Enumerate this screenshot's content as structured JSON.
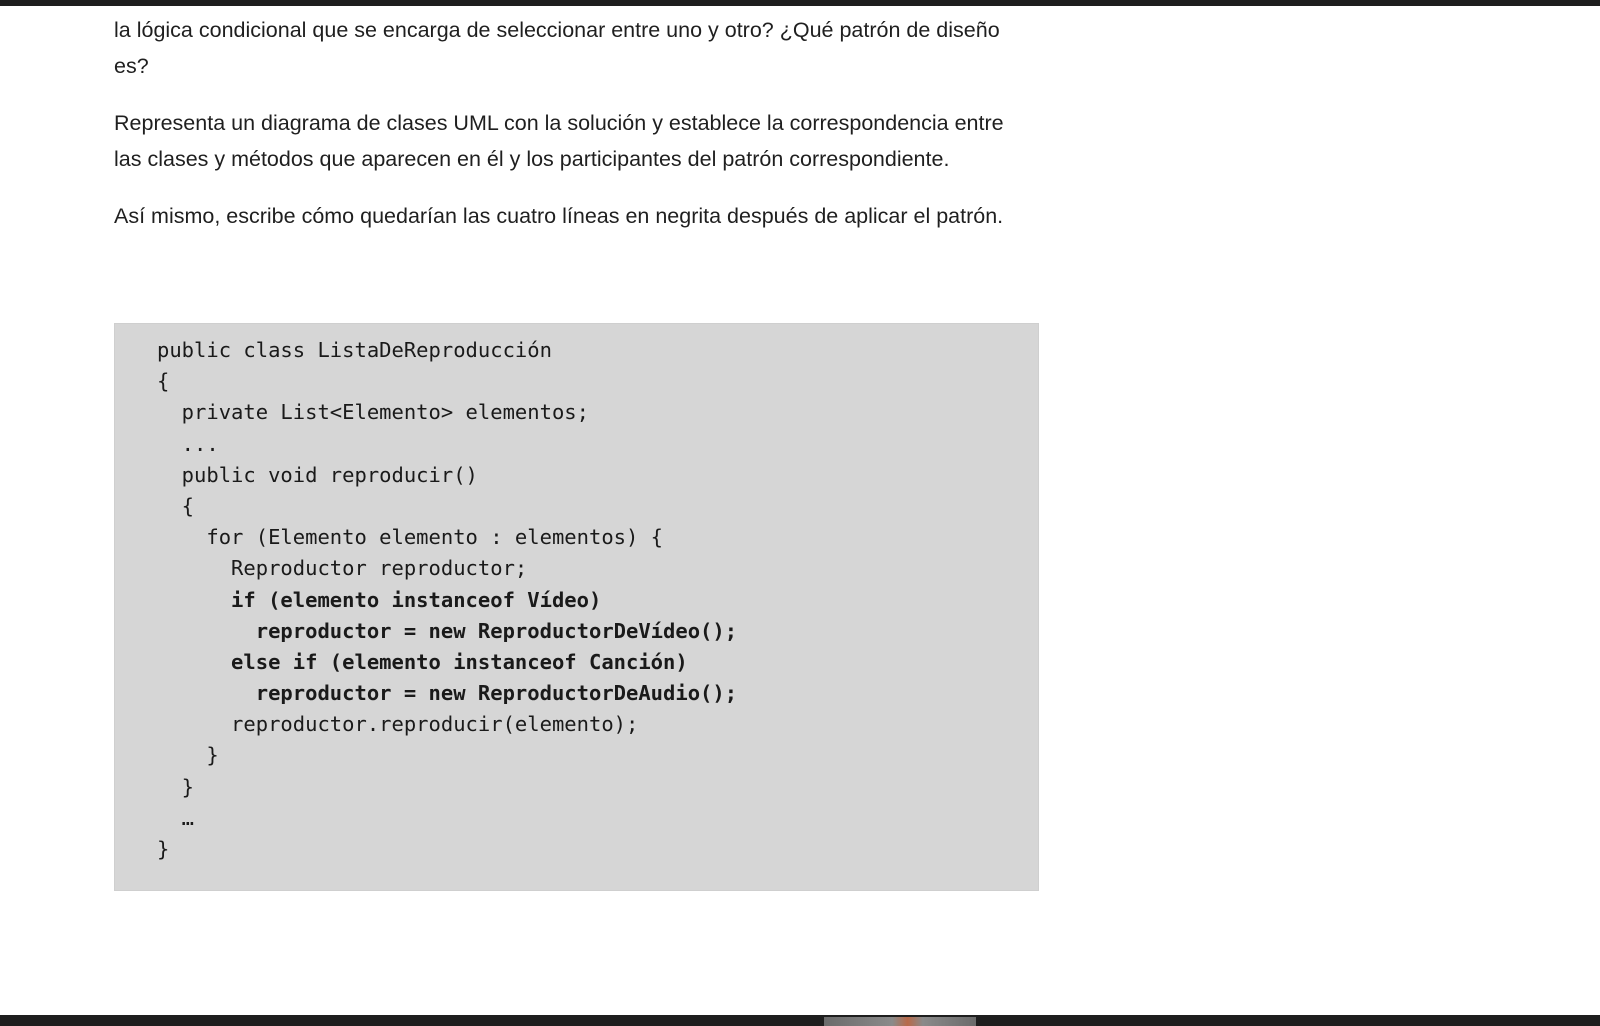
{
  "paragraphs": [
    "la lógica condicional que se encarga de seleccionar entre uno y otro? ¿Qué patrón de diseño es?",
    "Representa un diagrama de clases UML con la solución y establece la correspondencia entre las clases y métodos que aparecen en él y los participantes del patrón correspondiente.",
    "Así mismo, escribe cómo quedarían las cuatro líneas en negrita después de aplicar el patrón."
  ],
  "code": {
    "lines": [
      {
        "text": "public class ListaDeReproducción",
        "bold": false
      },
      {
        "text": "{",
        "bold": false
      },
      {
        "text": "  private List<Elemento> elementos;",
        "bold": false
      },
      {
        "text": "  ...",
        "bold": false
      },
      {
        "text": "  public void reproducir()",
        "bold": false
      },
      {
        "text": "  {",
        "bold": false
      },
      {
        "text": "    for (Elemento elemento : elementos) {",
        "bold": false
      },
      {
        "text": "      Reproductor reproductor;",
        "bold": false
      },
      {
        "text": "      if (elemento instanceof Vídeo)",
        "bold": true
      },
      {
        "text": "        reproductor = new ReproductorDeVídeo();",
        "bold": true
      },
      {
        "text": "      else if (elemento instanceof Canción)",
        "bold": true
      },
      {
        "text": "        reproductor = new ReproductorDeAudio();",
        "bold": true
      },
      {
        "text": "      reproductor.reproducir(elemento);",
        "bold": false
      },
      {
        "text": "    }",
        "bold": false
      },
      {
        "text": "  }",
        "bold": false
      },
      {
        "text": "  …",
        "bold": false
      },
      {
        "text": "}",
        "bold": false
      }
    ]
  }
}
